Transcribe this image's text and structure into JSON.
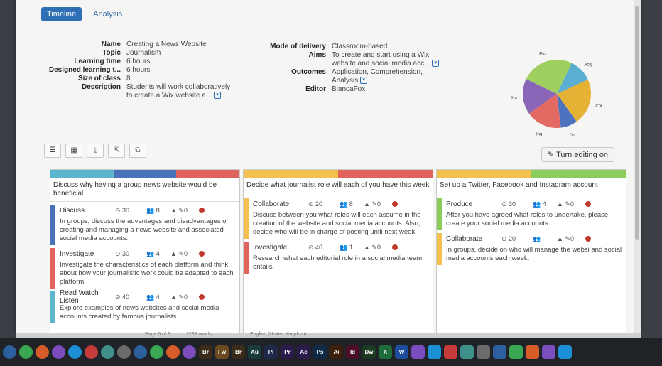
{
  "tabs": [
    {
      "label": "Timeline",
      "active": true
    },
    {
      "label": "Analysis",
      "active": false
    }
  ],
  "meta_left": [
    {
      "key": "Name",
      "value": "Creating a News Website"
    },
    {
      "key": "Topic",
      "value": "Journalism"
    },
    {
      "key": "Learning time",
      "value": "6 hours"
    },
    {
      "key": "Designed learning t...",
      "value": "6 hours"
    },
    {
      "key": "Size of class",
      "value": "8"
    },
    {
      "key": "Description",
      "value": "Students will work collaboratively"
    },
    {
      "key": "",
      "value": "to create a Wix website a..."
    }
  ],
  "meta_right": [
    {
      "key": "Mode of delivery",
      "value": "Classroom-based"
    },
    {
      "key": "Aims",
      "value": "To create and start using a Wix"
    },
    {
      "key": "",
      "value": "website and social media acc..."
    },
    {
      "key": "Outcomes",
      "value": "Application, Comprehension,"
    },
    {
      "key": "",
      "value": "Analysis"
    },
    {
      "key": "Editor",
      "value": "BiancaFox"
    }
  ],
  "chart_data": {
    "type": "pie",
    "categories": [
      "Acq",
      "Col",
      "Dis",
      "Inq",
      "Pra",
      "Pro"
    ],
    "values": [
      11,
      22,
      8,
      17,
      17,
      25
    ],
    "colors": [
      "#5aaed0",
      "#e5b235",
      "#4f72bf",
      "#e26a63",
      "#8a66b8",
      "#9ecf5f"
    ]
  },
  "toolbar_icons": [
    "list-view-icon",
    "grid-view-icon",
    "download-icon",
    "export-icon",
    "copy-icon"
  ],
  "edit_button": "Turn editing on",
  "columns": [
    {
      "bar": [
        "#5bb5cc",
        "#4a72b8",
        "#e0645c"
      ],
      "header": "Discuss why having a group news website would be beneficial",
      "activities": [
        {
          "name": "Discuss",
          "time": "30",
          "people": "8",
          "res": "0",
          "color": "#4a72b8",
          "desc": "In groups, discuss the advantages and disadvantages or creating and managing a news website and associated social media accounts."
        },
        {
          "name": "Investigate",
          "time": "30",
          "people": "4",
          "res": "0",
          "color": "#e0645c",
          "desc": "Investigate the characteristics of each platform and think about how your journalistic work could be adapted to each platform."
        },
        {
          "name": "Read Watch Listen",
          "time": "40",
          "people": "4",
          "res": "0",
          "color": "#5bb5cc",
          "desc": "Explore examples of news websites and social media accounts created by famous journalists."
        }
      ]
    },
    {
      "bar": [
        "#f2c14e",
        "#e0645c"
      ],
      "header": "Decide what journalist role will each of you have this week",
      "activities": [
        {
          "name": "Collaborate",
          "time": "20",
          "people": "8",
          "res": "0",
          "color": "#f2c14e",
          "desc": "Discuss between you what roles will each assume in the creation of the website and social media accounts. Also, decide who will be in charge of posting until next week"
        },
        {
          "name": "Investigate",
          "time": "40",
          "people": "1",
          "res": "0",
          "color": "#e0645c",
          "desc": "Research what each editorial role in a social media team entails."
        }
      ]
    },
    {
      "bar": [
        "#f2c14e",
        "#8ccc5a"
      ],
      "header": "Set up a Twitter, Facebook and Instagram account",
      "activities": [
        {
          "name": "Produce",
          "time": "30",
          "people": "4",
          "res": "0",
          "color": "#8ccc5a",
          "desc": "After you have agreed what roles to undertake, please create your social media accounts."
        },
        {
          "name": "Collaborate",
          "time": "20",
          "people": "",
          "res": "0",
          "color": "#f2c14e",
          "desc": "In groups, decide on who will manage the websi and social media accounts each week."
        }
      ]
    }
  ],
  "statusbar": {
    "page": "Page 6 of 9",
    "words": "2232 words",
    "lang": "English (United Kingdom)"
  },
  "dock": [
    "Br",
    "Fw",
    "Br",
    "Au",
    "Pl",
    "Pr",
    "Ae",
    "Ps",
    "Ai",
    "Id",
    "Dw",
    "X",
    "W"
  ]
}
